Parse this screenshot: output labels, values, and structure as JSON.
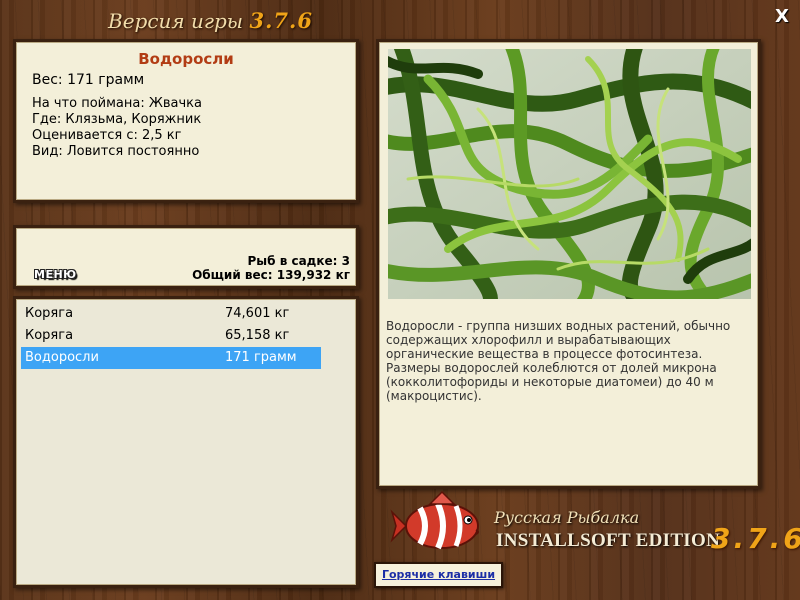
{
  "window": {
    "title_prefix": "Версия игры",
    "title_version": "3.7.6",
    "close_label": "X"
  },
  "fish_info": {
    "name": "Водоросли",
    "weight": "Вес: 171 грамм",
    "bait": "На что поймана: Жвачка",
    "location": "Где: Клязьма, Коряжник",
    "valued_from": "Оценивается с: 2,5 кг",
    "type": "Вид: Ловится постоянно"
  },
  "cage": {
    "menu_label": "МЕНЮ",
    "fish_count": "Рыб в садке: 3",
    "total_weight": "Общий вес: 139,932 кг"
  },
  "catch_list": [
    {
      "name": "Коряга",
      "weight": "74,601 кг",
      "selected": false
    },
    {
      "name": "Коряга",
      "weight": "65,158 кг",
      "selected": false
    },
    {
      "name": "Водоросли",
      "weight": "171 грамм",
      "selected": true
    }
  ],
  "description": "Водоросли - группа низших водных растений, обычно содержащих хлорофилл и вырабатывающих органические вещества в процессе фотосинтеза. Размеры водорослей колеблются от долей микрона (кокколитофориды и некоторые диатомеи) до 40 м (макроцистис).",
  "logo": {
    "line1": "Русская Рыбалка",
    "line2": "INSTALLSOFT EDITION",
    "version": "3.7.6"
  },
  "hotkeys_label": "Горячие клавиши",
  "colors": {
    "fish_name": "#b23c14",
    "selection": "#3da4f5",
    "version_accent": "#f0a418",
    "hotkey_link": "#1c2ea6"
  }
}
